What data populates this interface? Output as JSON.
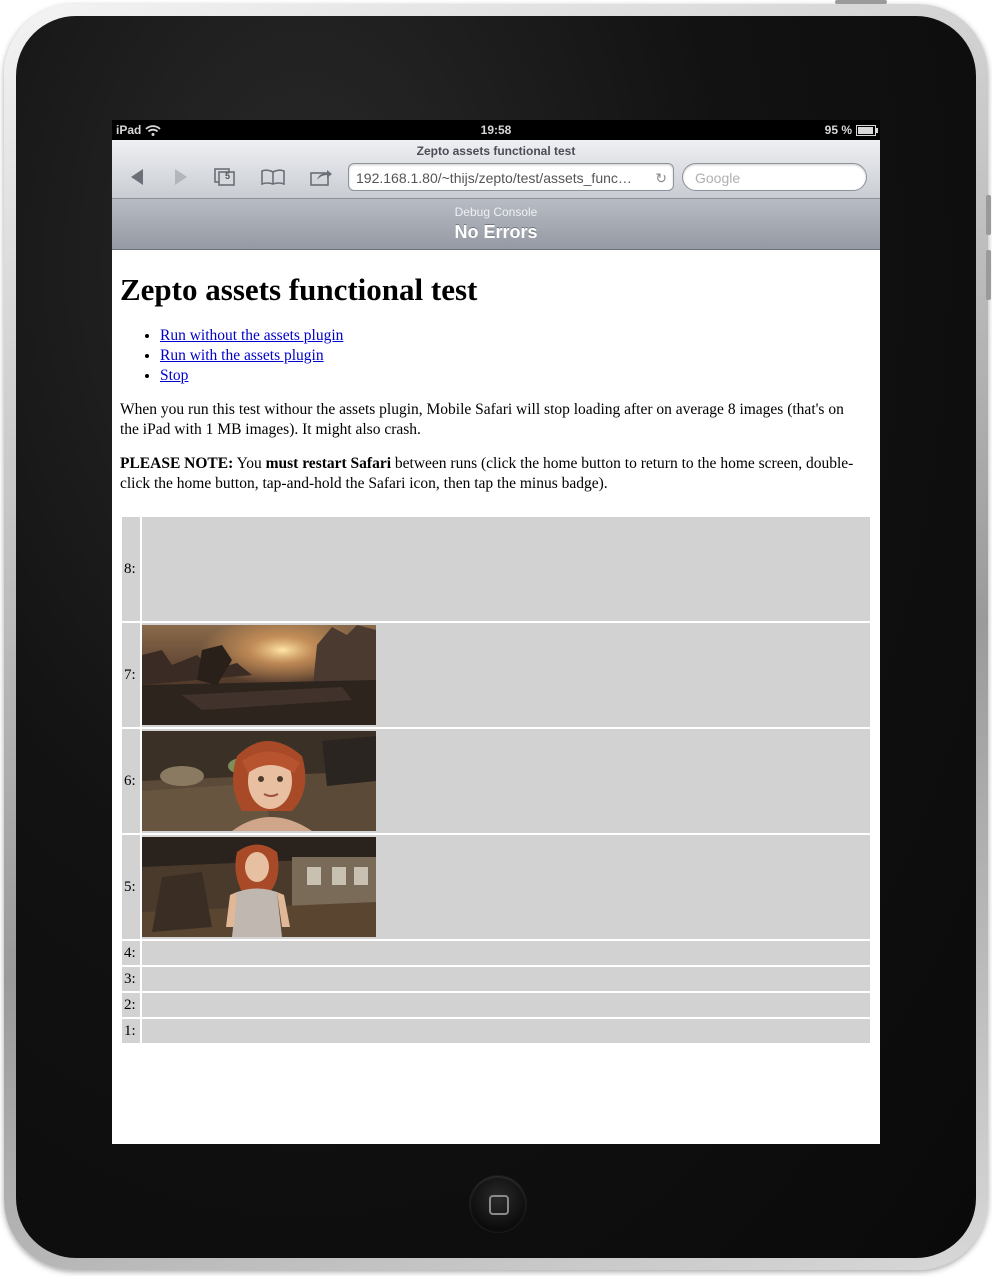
{
  "status_bar": {
    "carrier": "iPad",
    "time": "19:58",
    "battery": "95 %"
  },
  "browser": {
    "page_title": "Zepto assets functional test",
    "tabs_count": "5",
    "url": "192.168.1.80/~thijs/zepto/test/assets_func…",
    "search_placeholder": "Google"
  },
  "debug_console": {
    "label": "Debug Console",
    "status": "No Errors"
  },
  "content": {
    "heading": "Zepto assets functional test",
    "links": [
      {
        "label": "Run without the assets plugin"
      },
      {
        "label": "Run with the assets plugin"
      },
      {
        "label": "Stop"
      }
    ],
    "paragraph1": "When you run this test withour the assets plugin, Mobile Safari will stop loading after on average 8 images (that's on the iPad with 1 MB images). It might also crash.",
    "note_label": "PLEASE NOTE:",
    "note_you": "You",
    "note_emphasis": "must restart Safari",
    "note_rest": "between runs (click the home button to return to the home screen, double-click the home button, tap-and-hold the Safari icon, then tap the minus badge).",
    "rows": [
      {
        "label": "8:",
        "image": "none"
      },
      {
        "label": "7:",
        "image": "ruined-city-sunset"
      },
      {
        "label": "6:",
        "image": "red-haired-girl-closeup"
      },
      {
        "label": "5:",
        "image": "red-haired-girl-town"
      },
      {
        "label": "4:",
        "image": "none"
      },
      {
        "label": "3:",
        "image": "none"
      },
      {
        "label": "2:",
        "image": "none"
      },
      {
        "label": "1:",
        "image": "none"
      }
    ]
  },
  "icons": {
    "back": "back-arrow-icon",
    "forward": "forward-arrow-icon",
    "pages": "pages-icon",
    "bookmarks": "bookmarks-icon",
    "share": "share-icon",
    "reload": "reload-icon",
    "wifi": "wifi-icon",
    "battery": "battery-icon",
    "home": "home-button-icon"
  }
}
